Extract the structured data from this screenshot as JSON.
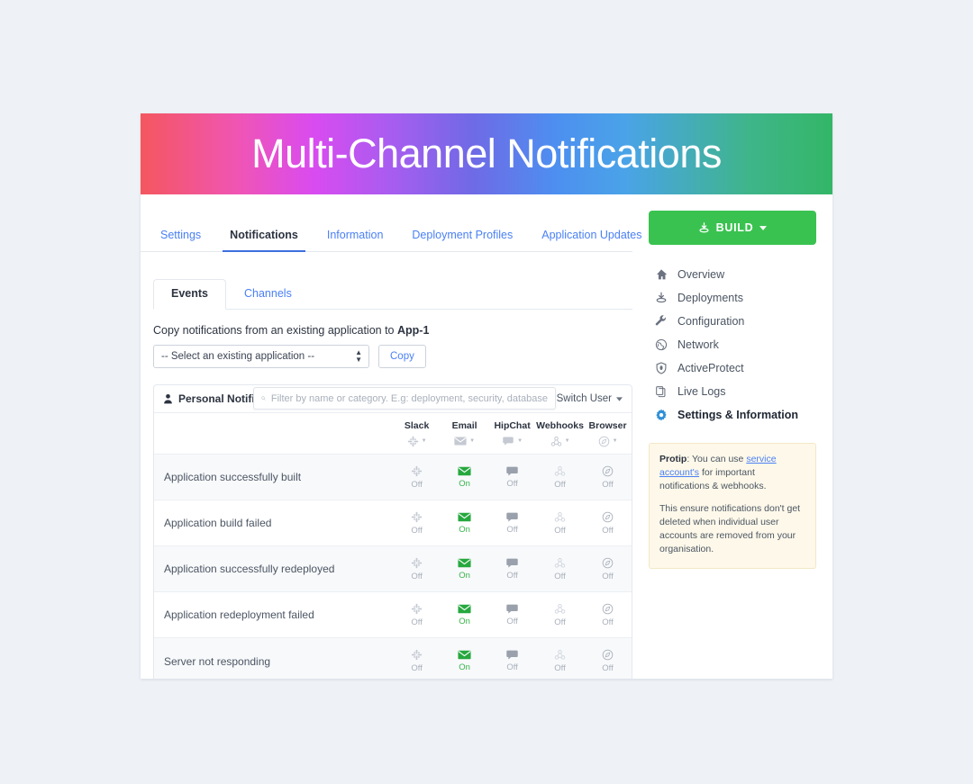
{
  "banner": {
    "title": "Multi-Channel Notifications"
  },
  "top_tabs": [
    {
      "label": "Settings",
      "active": false
    },
    {
      "label": "Notifications",
      "active": true
    },
    {
      "label": "Information",
      "active": false
    },
    {
      "label": "Deployment Profiles",
      "active": false
    },
    {
      "label": "Application Updates",
      "active": false
    }
  ],
  "sub_tabs": [
    {
      "label": "Events",
      "active": true
    },
    {
      "label": "Channels",
      "active": false
    }
  ],
  "copy_section": {
    "label_prefix": "Copy notifications from an existing application to ",
    "app_name": "App-1",
    "select_value": "-- Select an existing application --",
    "copy_button": "Copy"
  },
  "notifications_panel": {
    "header_title": "Personal Notifications",
    "switch_user": "Switch User",
    "filter_placeholder": "Filter by name or category. E.g: deployment, security, database",
    "channels": [
      {
        "name": "Slack",
        "icon": "slack-icon"
      },
      {
        "name": "Email",
        "icon": "envelope-icon"
      },
      {
        "name": "HipChat",
        "icon": "chat-bubble-icon"
      },
      {
        "name": "Webhooks",
        "icon": "webhook-icon"
      },
      {
        "name": "Browser",
        "icon": "compass-icon"
      }
    ],
    "rows": [
      {
        "event": "Application successfully built",
        "states": [
          "Off",
          "On",
          "Off",
          "Off",
          "Off"
        ]
      },
      {
        "event": "Application build failed",
        "states": [
          "Off",
          "On",
          "Off",
          "Off",
          "Off"
        ]
      },
      {
        "event": "Application successfully redeployed",
        "states": [
          "Off",
          "On",
          "Off",
          "Off",
          "Off"
        ]
      },
      {
        "event": "Application redeployment failed",
        "states": [
          "Off",
          "On",
          "Off",
          "Off",
          "Off"
        ]
      },
      {
        "event": "Server not responding",
        "states": [
          "Off",
          "On",
          "Off",
          "Off",
          "Off"
        ]
      }
    ]
  },
  "sidebar": {
    "build_button": "BUILD",
    "items": [
      {
        "label": "Overview",
        "icon": "home-icon",
        "active": false
      },
      {
        "label": "Deployments",
        "icon": "deploy-icon",
        "active": false
      },
      {
        "label": "Configuration",
        "icon": "wrench-icon",
        "active": false
      },
      {
        "label": "Network",
        "icon": "globe-icon",
        "active": false
      },
      {
        "label": "ActiveProtect",
        "icon": "shield-icon",
        "active": false
      },
      {
        "label": "Live Logs",
        "icon": "copy-icon",
        "active": false
      },
      {
        "label": "Settings & Information",
        "icon": "gear-icon",
        "active": true
      }
    ],
    "protip": {
      "bold": "Protip",
      "part1": ": You can use ",
      "link": "service account's",
      "part2": " for important notifications & webhooks.",
      "paragraph2": "This ensure notifications don't get deleted when individual user accounts are removed from your organisation."
    }
  },
  "colors": {
    "page_bg": "#eef1f6",
    "accent_green": "#3ac250",
    "link_blue": "#4a80f5",
    "on_green": "#36b348",
    "off_grey": "#a9b0bb",
    "protip_bg": "#fdf8e9"
  }
}
